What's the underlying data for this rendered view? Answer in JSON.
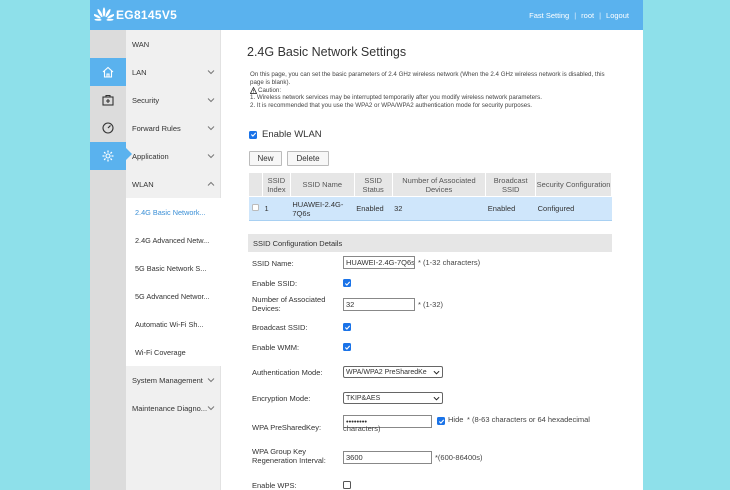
{
  "header": {
    "brand": "EG8145V5",
    "links": [
      "Fast Setting",
      "root",
      "Logout"
    ],
    "color": "#5ab2ee"
  },
  "icon_sidebar": [
    {
      "icon": "home-icon",
      "active": false
    },
    {
      "icon": "first-aid-icon",
      "active": false
    },
    {
      "icon": "dashboard-icon",
      "active": false
    },
    {
      "icon": "gear-icon",
      "active": true
    }
  ],
  "menu": {
    "items": [
      {
        "label": "WAN",
        "chevron": ""
      },
      {
        "label": "LAN",
        "chevron": "down"
      },
      {
        "label": "Security",
        "chevron": "down"
      },
      {
        "label": "Forward Rules",
        "chevron": "down"
      },
      {
        "label": "Application",
        "chevron": "down"
      },
      {
        "label": "WLAN",
        "chevron": "up"
      }
    ],
    "sub_items": [
      {
        "label": "2.4G Basic Network...",
        "active": true
      },
      {
        "label": "2.4G Advanced Netw...",
        "active": false
      },
      {
        "label": "5G Basic Network S...",
        "active": false
      },
      {
        "label": "5G Advanced Networ...",
        "active": false
      },
      {
        "label": "Automatic Wi-Fi Sh...",
        "active": false
      },
      {
        "label": "Wi-Fi Coverage",
        "active": false
      }
    ],
    "bottom_items": [
      {
        "label": "System Management",
        "chevron": "down"
      },
      {
        "label": "Maintenance Diagno...",
        "chevron": "down"
      }
    ]
  },
  "page": {
    "title": "2.4G Basic Network Settings",
    "description": "On this page, you can set the basic parameters of 2.4 GHz wireless network (When the 2.4 GHz wireless network is disabled, this page is blank).",
    "caution_label": "Caution:",
    "notes": [
      "1. Wireless network services may be interrupted temporarily after you modify wireless network parameters.",
      "2. It is recommended that you use the WPA2 or WPA/WPA2 authentication mode for security purposes."
    ],
    "enable_wlan_label": "Enable WLAN",
    "enable_wlan_checked": true,
    "new_label": "New",
    "delete_label": "Delete"
  },
  "ssid_table": {
    "headers": [
      "SSID Index",
      "SSID Name",
      "SSID Status",
      "Number of Associated Devices",
      "Broadcast SSID",
      "Security Configuration"
    ],
    "rows": [
      {
        "index": "1",
        "name": "HUAWEI-2.4G-7Q6s",
        "status": "Enabled",
        "devices": "32",
        "broadcast": "Enabled",
        "security": "Configured",
        "selected": true
      }
    ]
  },
  "config": {
    "section_title": "SSID Configuration Details",
    "ssid_name_label": "SSID Name:",
    "ssid_name_value": "HUAWEI-2.4G-7Q6s",
    "ssid_name_hint": "* (1-32 characters)",
    "enable_ssid_label": "Enable SSID:",
    "enable_ssid": true,
    "assoc_label": "Number of Associated Devices:",
    "assoc_value": "32",
    "assoc_hint": "* (1-32)",
    "broadcast_label": "Broadcast SSID:",
    "broadcast": true,
    "wmm_label": "Enable WMM:",
    "wmm": true,
    "auth_label": "Authentication Mode:",
    "auth_value": "WPA/WPA2 PreSharedKe",
    "enc_label": "Encryption Mode:",
    "enc_value": "TKIP&AES",
    "psk_label": "WPA PreSharedKey:",
    "psk_value": "••••••••",
    "hide_label": "Hide",
    "hide_checked": true,
    "psk_hint": "* (8-63 characters or 64 hexadecimal characters)",
    "regen_label": "WPA Group Key Regeneration Interval:",
    "regen_value": "3600",
    "regen_hint": "*(600-86400s)",
    "wps_label": "Enable WPS:",
    "wps": false
  }
}
